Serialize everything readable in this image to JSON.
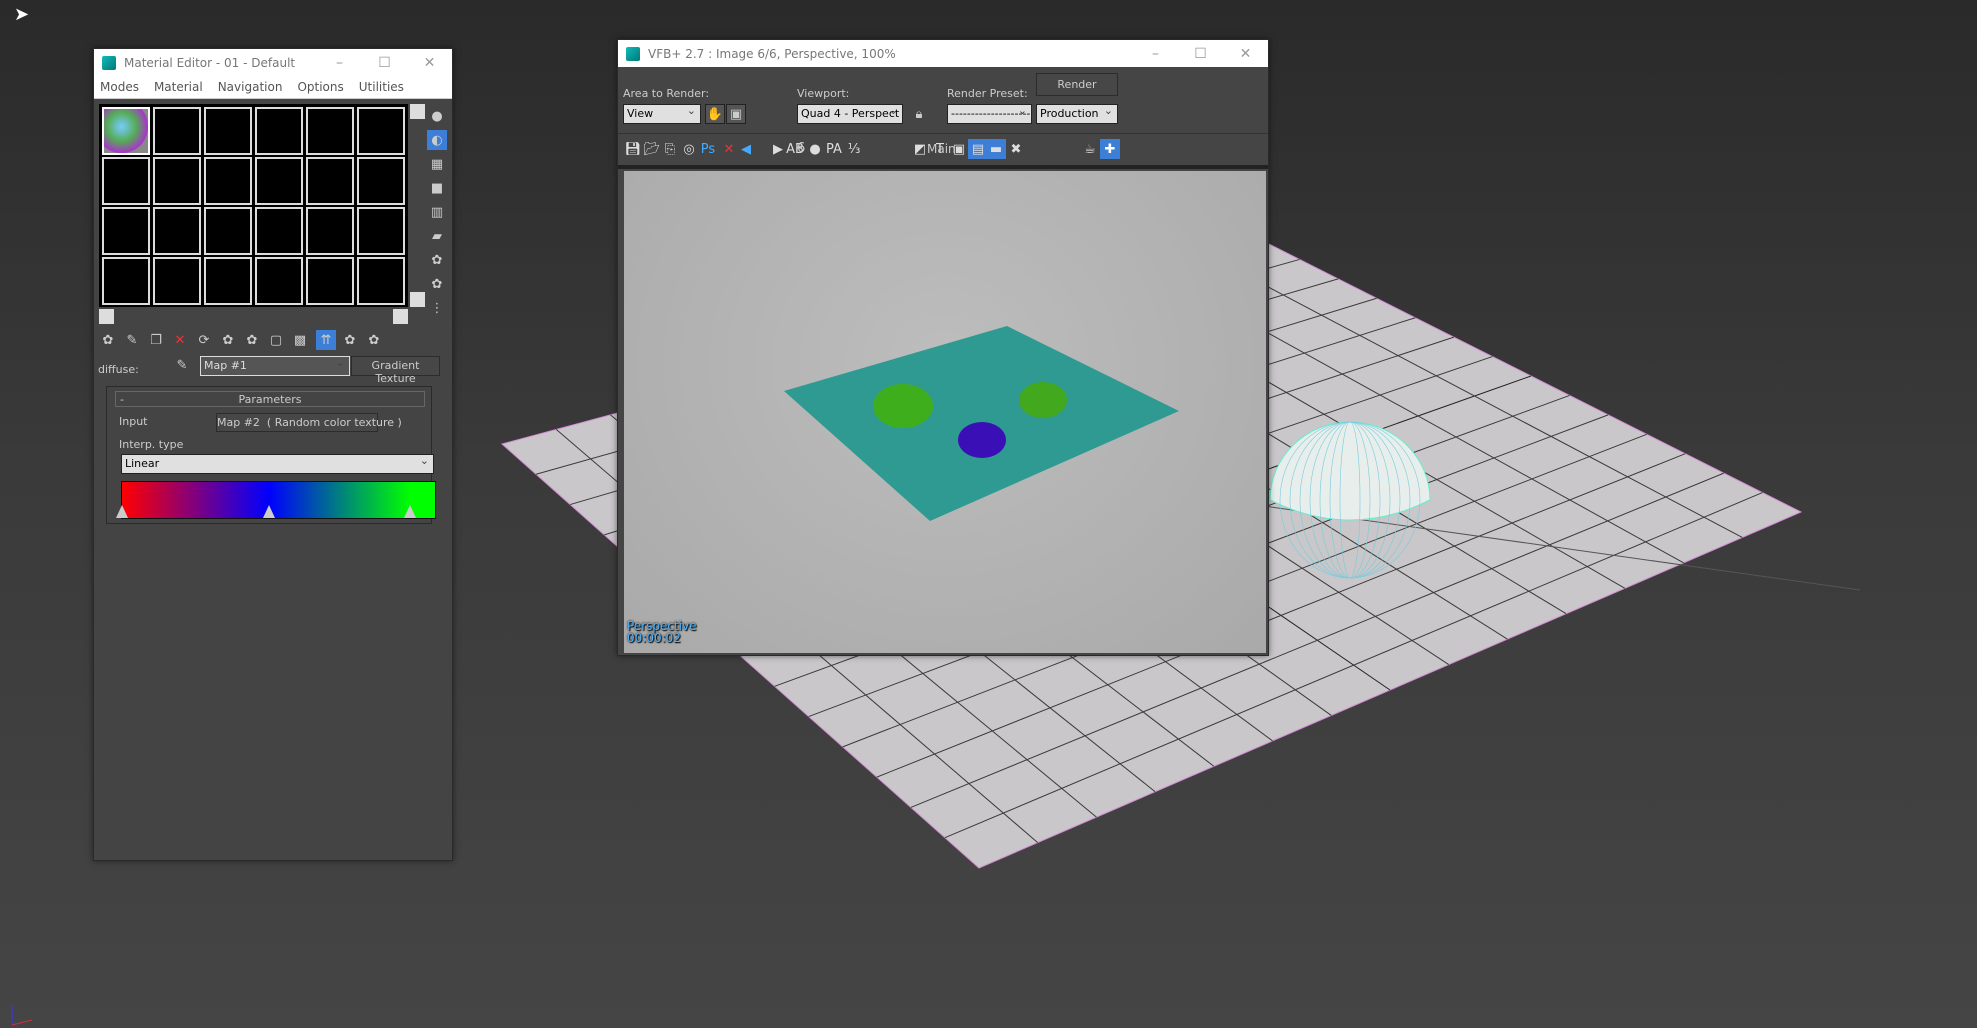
{
  "material_editor": {
    "title": "Material Editor - 01 - Default",
    "menu": [
      "Modes",
      "Material",
      "Navigation",
      "Options",
      "Utilities"
    ],
    "diffuse_label": "diffuse:",
    "map_name": "Map #1",
    "map_type": "Gradient Texture",
    "rollout": {
      "collapse": "-",
      "title": "Parameters",
      "input_label": "Input",
      "input_value": "Map #2  ( Random color texture )",
      "interp_label": "Interp. type",
      "interp_value": "Linear"
    },
    "gradient": {
      "colors": [
        "#ff0000",
        "#0000ff",
        "#00ff00"
      ],
      "stops": [
        0,
        0.47,
        0.92
      ]
    }
  },
  "vfb": {
    "title": "VFB+ 2.7 : Image 6/6, Perspective, 100%",
    "area_label": "Area to Render:",
    "area_value": "View",
    "viewport_label": "Viewport:",
    "viewport_value": "Quad 4 - Perspect",
    "preset_label": "Render Preset:",
    "preset_value": "--------------------",
    "render_button": "Render",
    "render_mode": "Production",
    "image_index": "6",
    "channel": "Main",
    "overlay_view": "Perspective",
    "overlay_time": "00:00:02"
  },
  "colors": {
    "accent": "#3d7fd6",
    "teal_plane": "#2e9a92",
    "sphere_green": "#3fae1c",
    "sphere_blue": "#3a0fb5"
  }
}
